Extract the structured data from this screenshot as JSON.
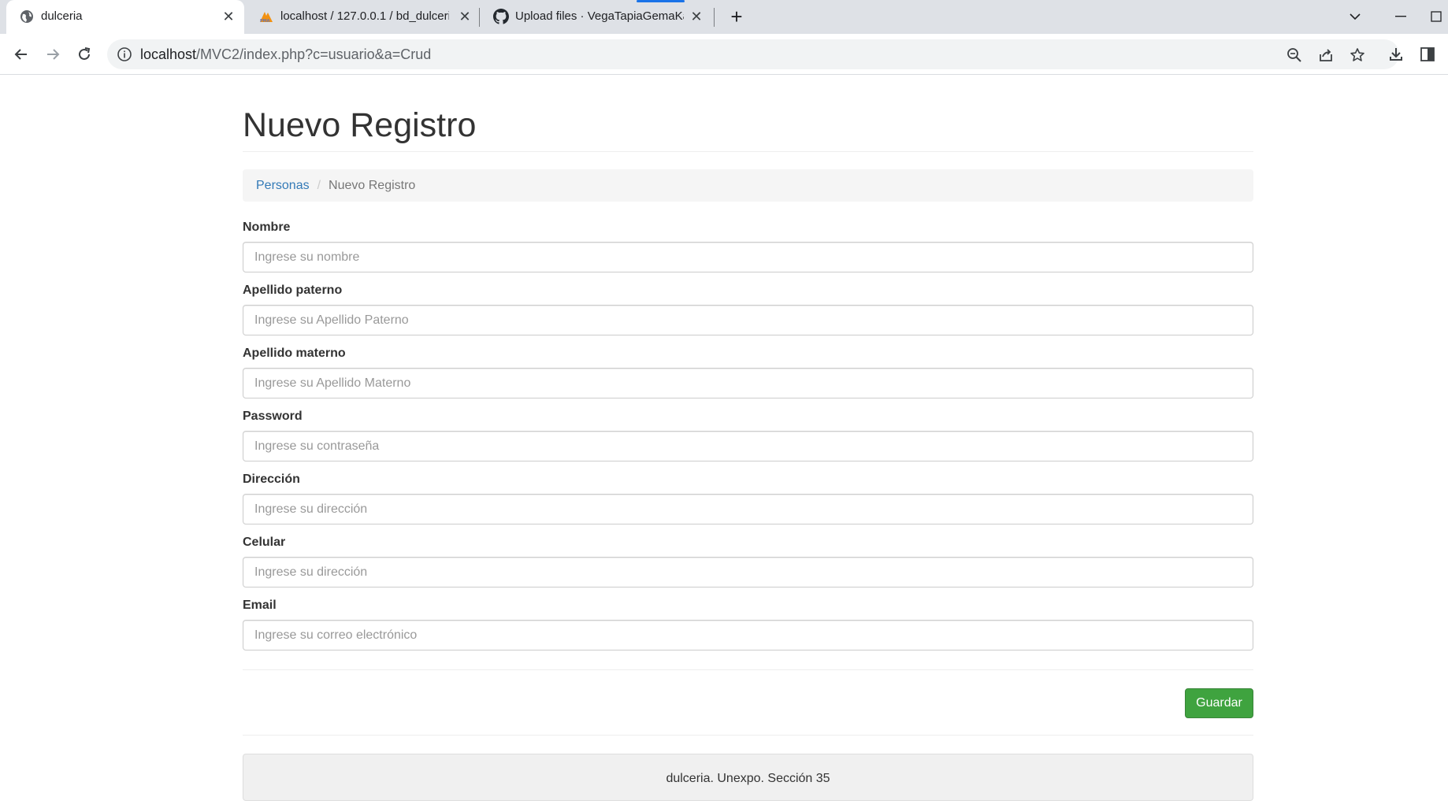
{
  "browser": {
    "tabs": [
      {
        "title": "dulceria",
        "icon": "globe-icon"
      },
      {
        "title": "localhost / 127.0.0.1 / bd_dulceri",
        "icon": "phpmyadmin-icon"
      },
      {
        "title": "Upload files · VegaTapiaGemaKa",
        "icon": "github-icon"
      }
    ],
    "url_host": "localhost",
    "url_path": "/MVC2/index.php?c=usuario&a=Crud"
  },
  "page": {
    "title": "Nuevo Registro",
    "breadcrumb": {
      "parent": "Personas",
      "current": "Nuevo Registro"
    },
    "form": {
      "fields": [
        {
          "label": "Nombre",
          "placeholder": "Ingrese su nombre",
          "value": ""
        },
        {
          "label": "Apellido paterno",
          "placeholder": "Ingrese su Apellido Paterno",
          "value": ""
        },
        {
          "label": "Apellido materno",
          "placeholder": "Ingrese su Apellido Materno",
          "value": ""
        },
        {
          "label": "Password",
          "placeholder": "Ingrese su contraseña",
          "value": ""
        },
        {
          "label": "Dirección",
          "placeholder": "Ingrese su dirección",
          "value": ""
        },
        {
          "label": "Celular",
          "placeholder": "Ingrese su dirección",
          "value": ""
        },
        {
          "label": "Email",
          "placeholder": "Ingrese su correo electrónico",
          "value": ""
        }
      ],
      "submit_label": "Guardar"
    },
    "footer": "dulceria. Unexpo. Sección 35"
  },
  "colors": {
    "link": "#337ab7",
    "success": "#3fa33f",
    "tab_loading": "#1a73e8"
  }
}
